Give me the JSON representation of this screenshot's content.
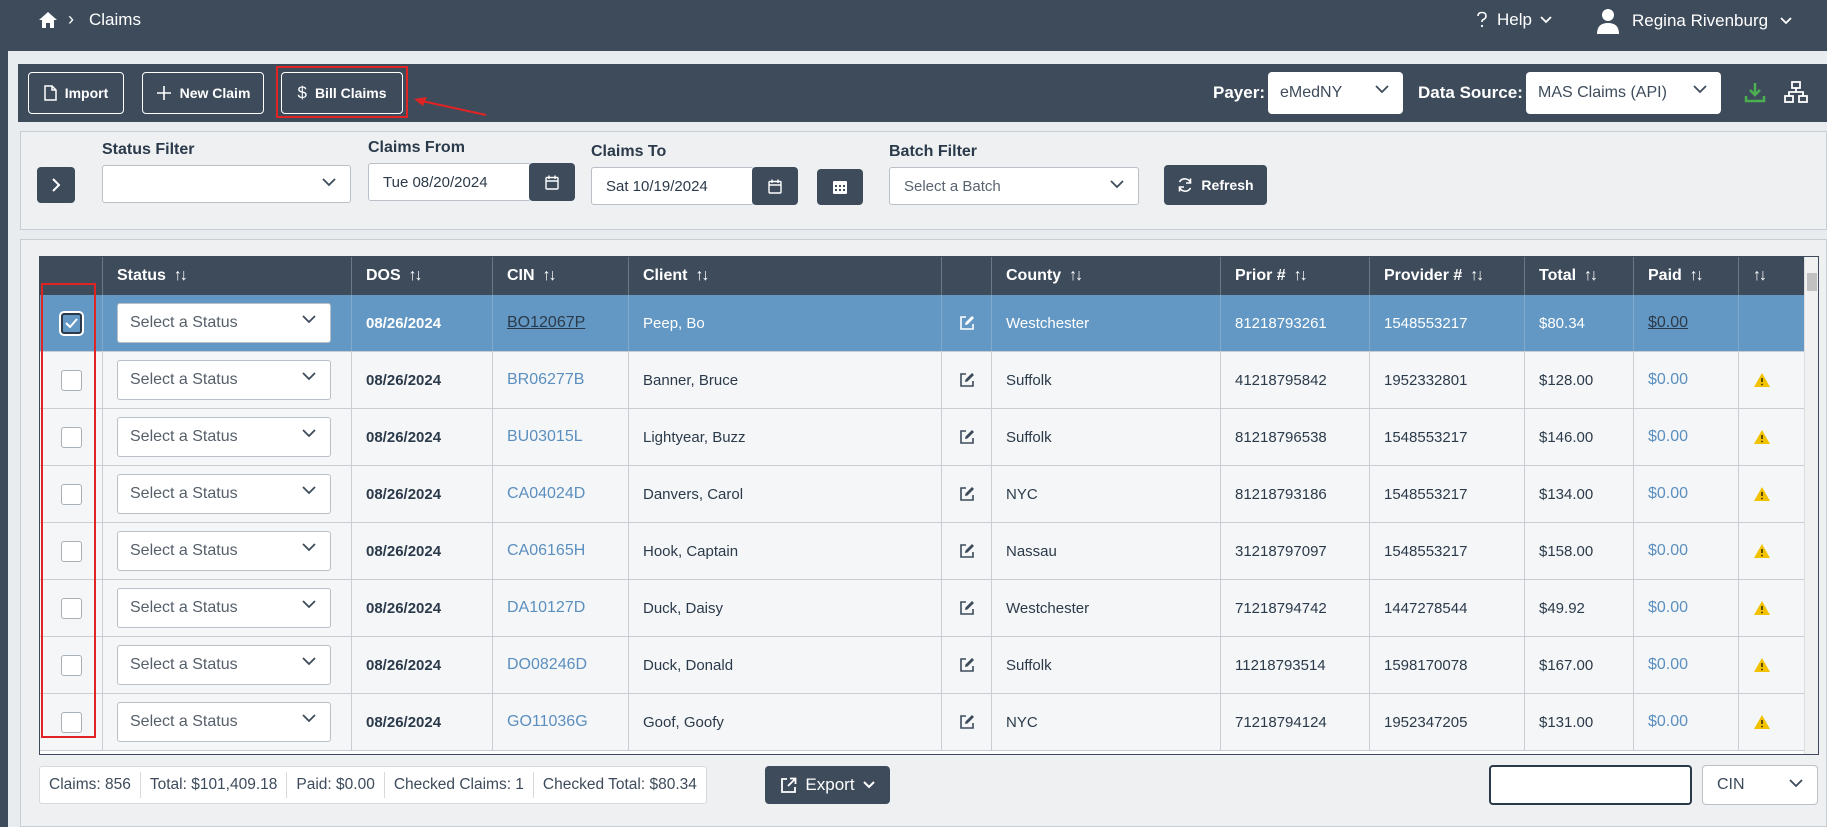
{
  "nav": {
    "breadcrumb": "Claims",
    "help": "Help",
    "user": "Regina Rivenburg"
  },
  "toolbar": {
    "import_label": "Import",
    "new_claim_label": "New Claim",
    "bill_claims_label": "Bill Claims",
    "payer_label": "Payer:",
    "payer_value": "eMedNY",
    "data_source_label": "Data Source:",
    "data_source_value": "MAS Claims (API)"
  },
  "filters": {
    "status_label": "Status Filter",
    "status_value": "",
    "claims_from_label": "Claims From",
    "claims_from_value": "Tue 08/20/2024",
    "claims_to_label": "Claims To",
    "claims_to_value": "Sat 10/19/2024",
    "batch_label": "Batch Filter",
    "batch_placeholder": "Select a Batch",
    "refresh_label": "Refresh"
  },
  "table": {
    "columns": [
      "Status",
      "DOS",
      "CIN",
      "Client",
      "County",
      "Prior #",
      "Provider #",
      "Total",
      "Paid"
    ],
    "status_placeholder": "Select a Status",
    "rows": [
      {
        "checked": true,
        "dos": "08/26/2024",
        "cin": "BO12067P",
        "client": "Peep, Bo",
        "county": "Westchester",
        "prior": "81218793261",
        "provider": "1548553217",
        "total": "$80.34",
        "paid": "$0.00",
        "warning": false
      },
      {
        "checked": false,
        "dos": "08/26/2024",
        "cin": "BR06277B",
        "client": "Banner, Bruce",
        "county": "Suffolk",
        "prior": "41218795842",
        "provider": "1952332801",
        "total": "$128.00",
        "paid": "$0.00",
        "warning": true
      },
      {
        "checked": false,
        "dos": "08/26/2024",
        "cin": "BU03015L",
        "client": "Lightyear, Buzz",
        "county": "Suffolk",
        "prior": "81218796538",
        "provider": "1548553217",
        "total": "$146.00",
        "paid": "$0.00",
        "warning": true
      },
      {
        "checked": false,
        "dos": "08/26/2024",
        "cin": "CA04024D",
        "client": "Danvers, Carol",
        "county": "NYC",
        "prior": "81218793186",
        "provider": "1548553217",
        "total": "$134.00",
        "paid": "$0.00",
        "warning": true
      },
      {
        "checked": false,
        "dos": "08/26/2024",
        "cin": "CA06165H",
        "client": "Hook, Captain",
        "county": "Nassau",
        "prior": "31218797097",
        "provider": "1548553217",
        "total": "$158.00",
        "paid": "$0.00",
        "warning": true
      },
      {
        "checked": false,
        "dos": "08/26/2024",
        "cin": "DA10127D",
        "client": "Duck, Daisy",
        "county": "Westchester",
        "prior": "71218794742",
        "provider": "1447278544",
        "total": "$49.92",
        "paid": "$0.00",
        "warning": true
      },
      {
        "checked": false,
        "dos": "08/26/2024",
        "cin": "DO08246D",
        "client": "Duck, Donald",
        "county": "Suffolk",
        "prior": "11218793514",
        "provider": "1598170078",
        "total": "$167.00",
        "paid": "$0.00",
        "warning": true
      },
      {
        "checked": false,
        "dos": "08/26/2024",
        "cin": "GO11036G",
        "client": "Goof, Goofy",
        "county": "NYC",
        "prior": "71218794124",
        "provider": "1952347205",
        "total": "$131.00",
        "paid": "$0.00",
        "warning": true
      }
    ]
  },
  "footer": {
    "claims": "Claims: 856",
    "total": "Total: $101,409.18",
    "paid": "Paid: $0.00",
    "checked_claims": "Checked Claims: 1",
    "checked_total": "Checked Total: $80.34",
    "export_label": "Export",
    "search_value": "",
    "search_field": "CIN"
  },
  "colors": {
    "nav_bg": "#3d4b5b",
    "selected_row": "#6398c4",
    "link": "#5b8fbf",
    "warning": "#f2c200",
    "highlight": "#e02424",
    "download_icon": "#4caf50"
  }
}
